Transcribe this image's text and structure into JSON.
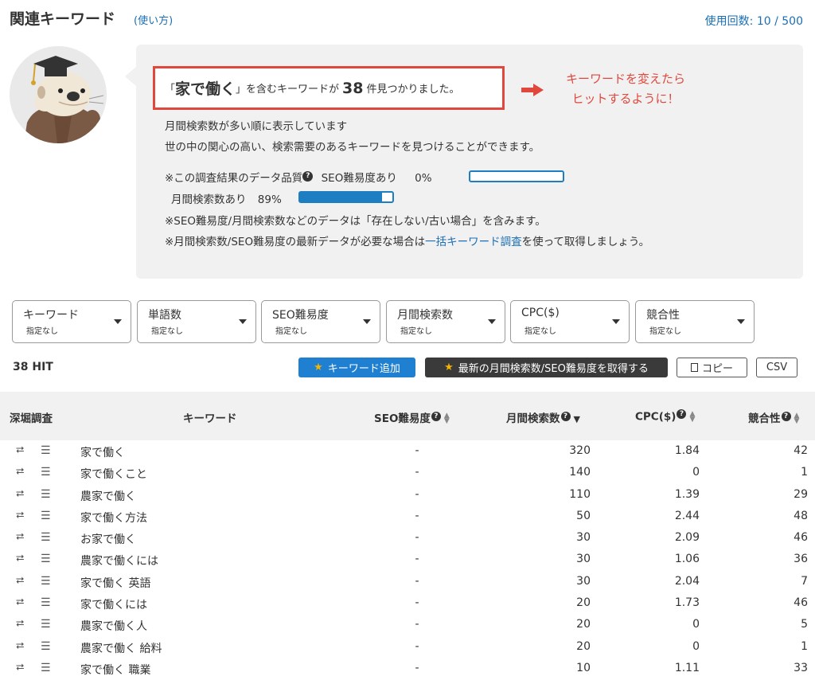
{
  "header": {
    "title": "関連キーワード",
    "howto_link": "(使い方)",
    "usage": "使用回数: 10 / 500"
  },
  "result": {
    "open_bracket": "「",
    "keyword": "家で働く",
    "middle": "」を含むキーワードが",
    "count": "38",
    "suffix": "件見つかりました。"
  },
  "annotation": {
    "line1": "キーワードを変えたら",
    "line2": "ヒットするように！"
  },
  "description": {
    "line1": "月間検索数が多い順に表示しています",
    "line2": "世の中の関心の高い、検索需要のあるキーワードを見つけることができます。"
  },
  "quality": {
    "label": "※この調査結果のデータ品質",
    "help_icon": "?",
    "seo_label": "SEO難易度あり",
    "seo_percent": "0%",
    "seo_fraction": 0.0,
    "volume_label": "月間検索数あり",
    "volume_percent": "89%",
    "volume_fraction": 0.89
  },
  "notes": {
    "note1": "※SEO難易度/月間検索数などのデータは「存在しない/古い場合」を含みます。",
    "note2_pre": "※月間検索数/SEO難易度の最新データが必要な場合は",
    "note2_link": "一括キーワード調査",
    "note2_post": "を使って取得しましょう。"
  },
  "filters": [
    {
      "label": "キーワード",
      "value": "指定なし"
    },
    {
      "label": "単語数",
      "value": "指定なし"
    },
    {
      "label": "SEO難易度",
      "value": "指定なし"
    },
    {
      "label": "月間検索数",
      "value": "指定なし"
    },
    {
      "label": "CPC($)",
      "value": "指定なし"
    },
    {
      "label": "競合性",
      "value": "指定なし"
    }
  ],
  "toolbar": {
    "hit_count": "38 HIT",
    "add_keyword": "キーワード追加",
    "fetch_latest": "最新の月間検索数/SEO難易度を取得する",
    "copy": "コピー",
    "csv": "CSV"
  },
  "table": {
    "headers": {
      "dig": "深堀調査",
      "keyword": "キーワード",
      "seo": "SEO難易度",
      "volume": "月間検索数",
      "cpc": "CPC($)",
      "competition": "競合性"
    },
    "rows": [
      {
        "keyword": "家で働く",
        "seo": "-",
        "volume": "320",
        "cpc": "1.84",
        "competition": "42"
      },
      {
        "keyword": "家で働くこと",
        "seo": "-",
        "volume": "140",
        "cpc": "0",
        "competition": "1"
      },
      {
        "keyword": "農家で働く",
        "seo": "-",
        "volume": "110",
        "cpc": "1.39",
        "competition": "29"
      },
      {
        "keyword": "家で働く方法",
        "seo": "-",
        "volume": "50",
        "cpc": "2.44",
        "competition": "48"
      },
      {
        "keyword": "お家で働く",
        "seo": "-",
        "volume": "30",
        "cpc": "2.09",
        "competition": "46"
      },
      {
        "keyword": "農家で働くには",
        "seo": "-",
        "volume": "30",
        "cpc": "1.06",
        "competition": "36"
      },
      {
        "keyword": "家で働く 英語",
        "seo": "-",
        "volume": "30",
        "cpc": "2.04",
        "competition": "7"
      },
      {
        "keyword": "家で働くには",
        "seo": "-",
        "volume": "20",
        "cpc": "1.73",
        "competition": "46"
      },
      {
        "keyword": "農家で働く人",
        "seo": "-",
        "volume": "20",
        "cpc": "0",
        "competition": "5"
      },
      {
        "keyword": "農家で働く 給料",
        "seo": "-",
        "volume": "20",
        "cpc": "0",
        "competition": "1"
      },
      {
        "keyword": "家で働く 職業",
        "seo": "-",
        "volume": "10",
        "cpc": "1.11",
        "competition": "33"
      }
    ]
  },
  "colors": {
    "accent": "#1a6fb5",
    "highlight_red": "#e0483e",
    "bar_blue": "#1d7fc2"
  }
}
